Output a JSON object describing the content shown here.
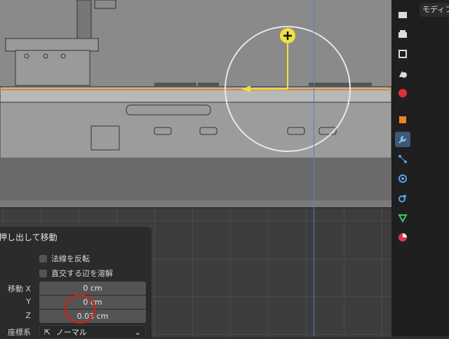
{
  "operator": {
    "title": "押し出して移動",
    "flip_normals_label": "法線を反転",
    "dissolve_label": "直交する辺を溶解",
    "move_x_label": "移動 X",
    "move_x_value": "0 cm",
    "move_y_label": "Y",
    "move_y_value": "0 cm",
    "move_z_label": "Z",
    "move_z_value": "0.03 cm",
    "orientation_label": "座標系",
    "orientation_value": "ノーマル"
  },
  "properties": {
    "tab_label": "モディファ"
  },
  "colors": {
    "active_tool": "#3f5677",
    "gizmo": "#f0e040",
    "annotation": "#e01818",
    "edge_highlight": "#e08a2a"
  },
  "tools": [
    "render-icon",
    "output-icon",
    "view-layer-icon",
    "scene-icon",
    "world-icon",
    "object-icon",
    "wrench-icon",
    "particles-icon",
    "physics-icon",
    "constraints-icon",
    "data-icon",
    "material-icon"
  ]
}
